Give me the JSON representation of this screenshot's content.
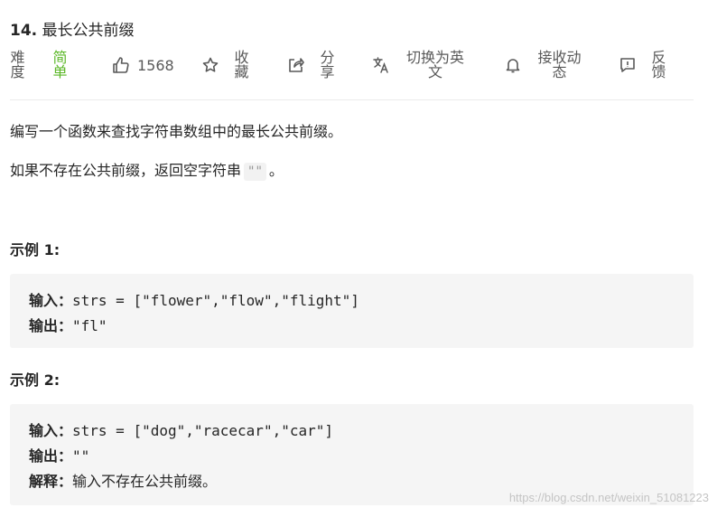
{
  "problem": {
    "number": "14.",
    "title": "最长公共前缀"
  },
  "toolbar": {
    "difficulty_label": "难度",
    "difficulty_value": "简单",
    "likes": "1568",
    "favorite_label": "收藏",
    "share_label": "分享",
    "translate_label": "切换为英文",
    "notify_label": "接收动态",
    "feedback_label": "反馈"
  },
  "description": {
    "line1": "编写一个函数来查找字符串数组中的最长公共前缀。",
    "line2_prefix": "如果不存在公共前缀，返回空字符串",
    "line2_code": "\"\"",
    "line2_suffix": "。"
  },
  "examples": [
    {
      "title": "示例 1:",
      "input_label": "输入：",
      "input_value": "strs = [\"flower\",\"flow\",\"flight\"]",
      "output_label": "输出：",
      "output_value": "\"fl\""
    },
    {
      "title": "示例 2:",
      "input_label": "输入：",
      "input_value": "strs = [\"dog\",\"racecar\",\"car\"]",
      "output_label": "输出：",
      "output_value": "\"\"",
      "explain_label": "解释：",
      "explain_value": "输入不存在公共前缀。"
    }
  ],
  "watermark": "https://blog.csdn.net/weixin_51081223",
  "colors": {
    "easy": "#5ab726",
    "text": "#262626",
    "muted": "#595959",
    "codebox": "#f5f5f5"
  },
  "icons": [
    "thumbs-up-icon",
    "star-icon",
    "share-icon",
    "translate-icon",
    "bell-icon",
    "feedback-icon"
  ]
}
